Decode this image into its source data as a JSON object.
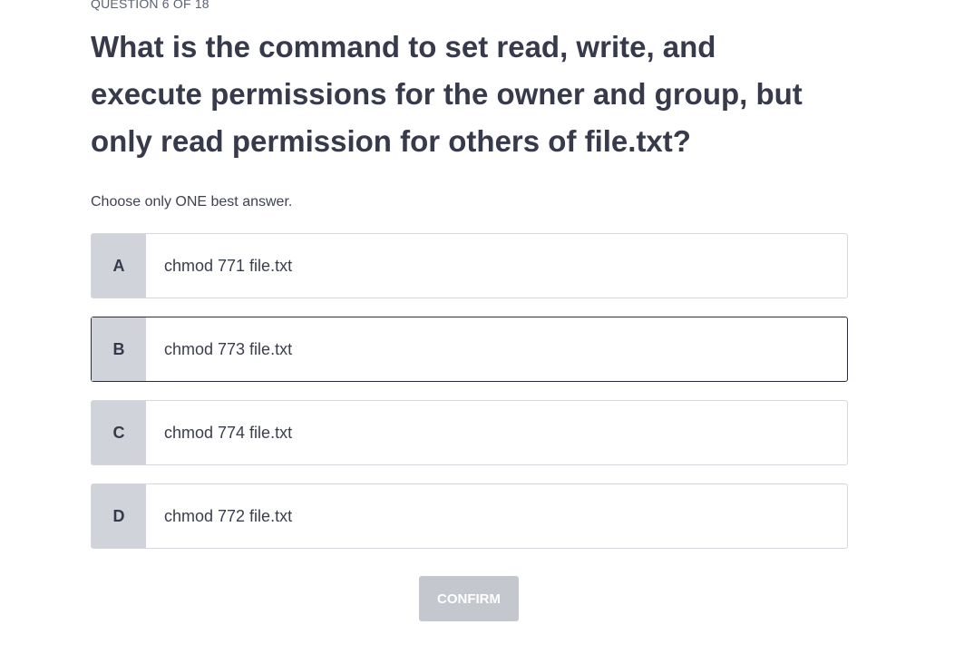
{
  "quiz": {
    "counter": "QUESTION 6 OF 18",
    "question": "What is the command to set read, write, and execute permissions for the owner and group, but only read permission for others of file.txt?",
    "instruction": "Choose only ONE best answer.",
    "options": [
      {
        "letter": "A",
        "text": "chmod 771 file.txt"
      },
      {
        "letter": "B",
        "text": "chmod 773 file.txt"
      },
      {
        "letter": "C",
        "text": "chmod 774 file.txt"
      },
      {
        "letter": "D",
        "text": "chmod 772 file.txt"
      }
    ],
    "hovered_option": "B",
    "confirm_label": "CONFIRM",
    "confirm_enabled": false
  },
  "colors": {
    "letter_bg": "#d1d3da",
    "border": "#d7d8de",
    "hover_border": "#2b2e3a",
    "confirm_disabled_bg": "#c5c7ce"
  }
}
